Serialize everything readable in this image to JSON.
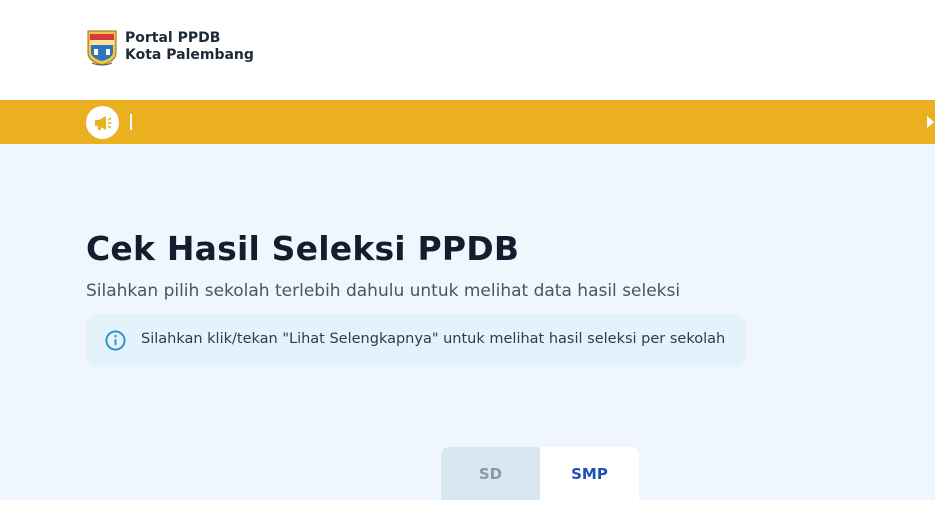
{
  "header": {
    "brand_line1": "Portal PPDB",
    "brand_line2": "Kota Palembang",
    "logo_icon": "palembang-coat-of-arms-icon"
  },
  "announcement": {
    "icon": "megaphone-icon",
    "text": "",
    "next_icon": "play-arrow-icon",
    "bar_color": "#ebb020"
  },
  "main": {
    "title": "Cek Hasil Seleksi PPDB",
    "subtitle": "Silahkan pilih sekolah terlebih dahulu untuk melihat data hasil seleksi",
    "info": {
      "icon": "info-circle-icon",
      "text": "Silahkan klik/tekan \"Lihat Selengkapnya\" untuk melihat hasil seleksi per sekolah"
    },
    "tabs": [
      {
        "label": "SD",
        "active": false
      },
      {
        "label": "SMP",
        "active": true
      }
    ]
  },
  "colors": {
    "background": "#eff6fe",
    "accent": "#1e50b4",
    "title": "#141c2e"
  }
}
